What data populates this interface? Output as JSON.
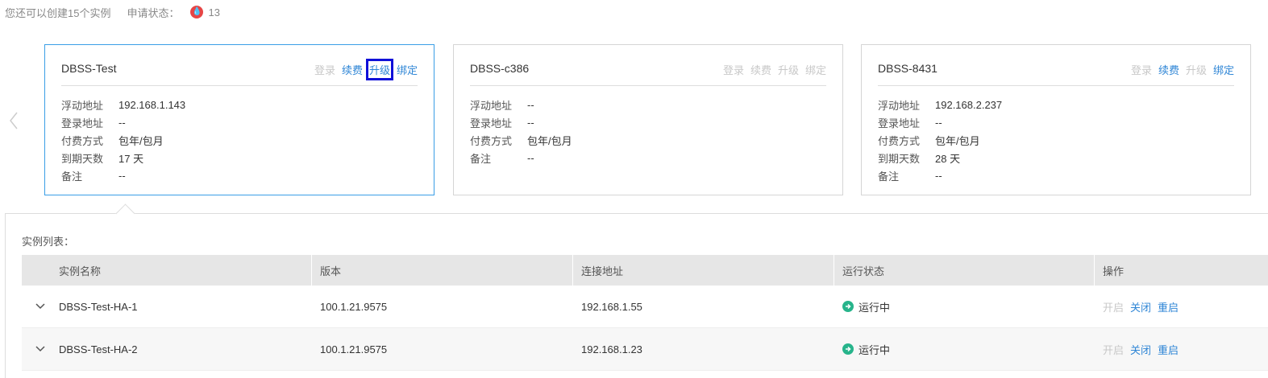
{
  "top": {
    "remaining_text": "您还可以创建15个实例",
    "apply_label": "申请状态：",
    "apply_count": "13",
    "badge_color": "#e64545"
  },
  "nav": {
    "prev_icon": "chevron-left-icon"
  },
  "cards": [
    {
      "title": "DBSS-Test",
      "actions": {
        "login": "登录",
        "renew": "续费",
        "upgrade": "升级",
        "bind": "绑定"
      },
      "fields": [
        {
          "key": "浮动地址",
          "value": "192.168.1.143"
        },
        {
          "key": "登录地址",
          "value": "--"
        },
        {
          "key": "付费方式",
          "value": "包年/包月"
        },
        {
          "key": "到期天数",
          "value": "17 天"
        },
        {
          "key": "备注",
          "value": "--"
        }
      ]
    },
    {
      "title": "DBSS-c386",
      "actions": {
        "login": "登录",
        "renew": "续费",
        "upgrade": "升级",
        "bind": "绑定"
      },
      "fields": [
        {
          "key": "浮动地址",
          "value": "--"
        },
        {
          "key": "登录地址",
          "value": "--"
        },
        {
          "key": "付费方式",
          "value": "包年/包月"
        },
        {
          "key": "备注",
          "value": "--"
        }
      ]
    },
    {
      "title": "DBSS-8431",
      "actions": {
        "login": "登录",
        "renew": "续费",
        "upgrade": "升级",
        "bind": "绑定"
      },
      "fields": [
        {
          "key": "浮动地址",
          "value": "192.168.2.237"
        },
        {
          "key": "登录地址",
          "value": "--"
        },
        {
          "key": "付费方式",
          "value": "包年/包月"
        },
        {
          "key": "到期天数",
          "value": "28 天"
        },
        {
          "key": "备注",
          "value": "--"
        }
      ]
    }
  ],
  "list": {
    "title": "实例列表：",
    "columns": [
      "实例名称",
      "版本",
      "连接地址",
      "运行状态",
      "操作"
    ],
    "rows": [
      {
        "name": "DBSS-Test-HA-1",
        "version": "100.1.21.9575",
        "address": "192.168.1.55",
        "status": "运行中",
        "ops": [
          "开启",
          "关闭",
          "重启"
        ]
      },
      {
        "name": "DBSS-Test-HA-2",
        "version": "100.1.21.9575",
        "address": "192.168.1.23",
        "status": "运行中",
        "ops": [
          "开启",
          "关闭",
          "重启"
        ]
      }
    ]
  },
  "colors": {
    "link": "#2f86d6",
    "disabled": "#c8c8c8",
    "active_border": "#3a9ee6",
    "status_ok": "#27b48b",
    "highlight": "#1010d8"
  }
}
